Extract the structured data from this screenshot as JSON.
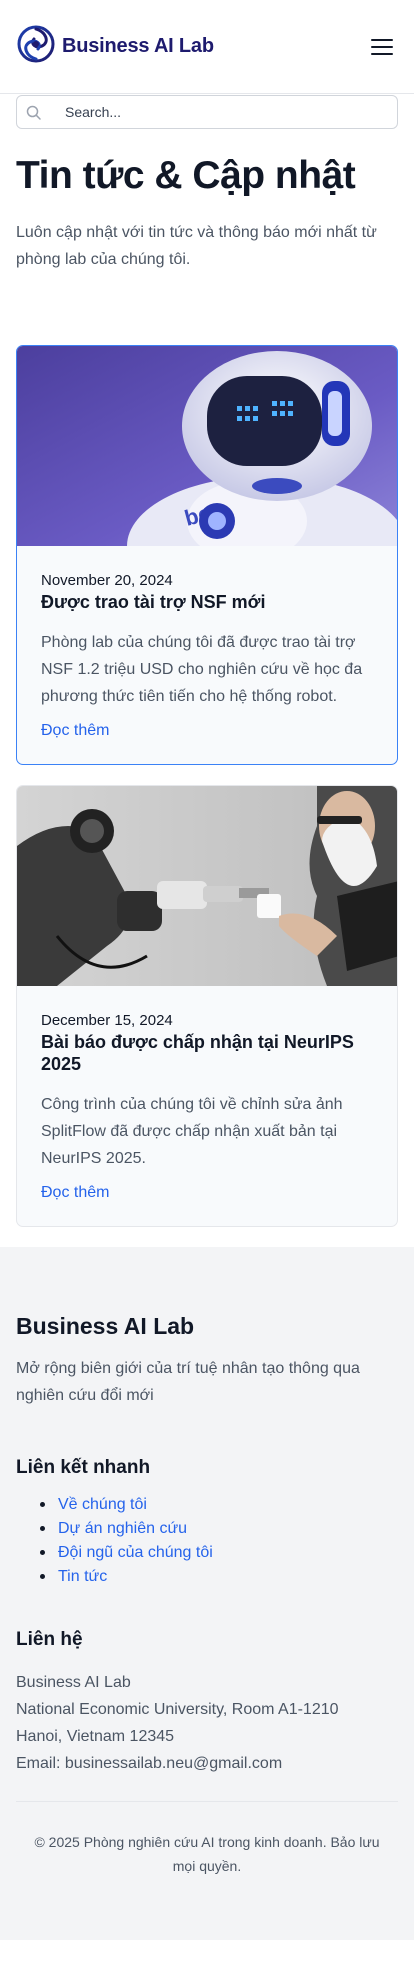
{
  "header": {
    "brand_name": "Business AI Lab",
    "logo_icon": "swirl-logo-icon",
    "menu_icon": "hamburger-menu-icon"
  },
  "search": {
    "placeholder": "Search...",
    "value": ""
  },
  "hero": {
    "title": "Tin tức & Cập nhật",
    "subtitle": "Luôn cập nhật với tin tức và thông báo mới nhất từ phòng lab của chúng tôi."
  },
  "news": [
    {
      "date": "November 20, 2024",
      "title": "Được trao tài trợ NSF mới",
      "summary": "Phòng lab của chúng tôi đã được trao tài trợ NSF 1.2 triệu USD cho nghiên cứu về học đa phương thức tiên tiến cho hệ thống robot.",
      "link_label": "Đọc thêm",
      "image": "humanoid-robot-image"
    },
    {
      "date": "December 15, 2024",
      "title": "Bài báo được chấp nhận tại NeurIPS 2025",
      "summary": "Công trình của chúng tôi về chỉnh sửa ảnh SplitFlow đã được chấp nhận xuất bản tại NeurIPS 2025.",
      "link_label": "Đọc thêm",
      "image": "robot-arm-coffee-image"
    }
  ],
  "footer": {
    "brand_name": "Business AI Lab",
    "tagline": "Mở rộng biên giới của trí tuệ nhân tạo thông qua nghiên cứu đổi mới",
    "links_title": "Liên kết nhanh",
    "links": [
      "Về chúng tôi",
      "Dự án nghiên cứu",
      "Đội ngũ của chúng tôi",
      "Tin tức"
    ],
    "contact_title": "Liên hệ",
    "contact_lines": [
      "Business AI Lab",
      "National Economic University, Room A1-1210",
      "Hanoi, Vietnam 12345",
      "Email: businessailab.neu@gmail.com"
    ],
    "copyright": "© 2025 Phòng nghiên cứu AI trong kinh doanh. Bảo lưu mọi quyền."
  },
  "colors": {
    "brand": "#1e1b6e",
    "link": "#2563eb",
    "active_border": "#3b82f6",
    "footer_bg": "#f3f4f6"
  }
}
